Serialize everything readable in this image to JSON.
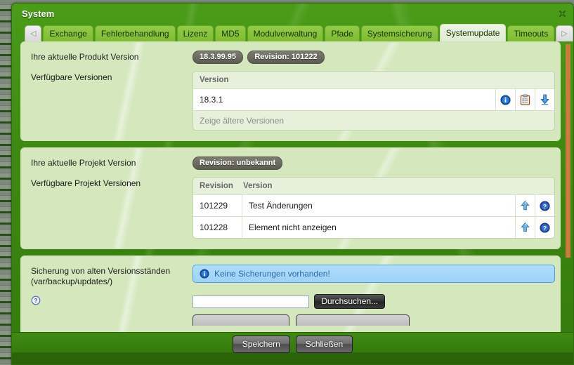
{
  "window": {
    "title": "System",
    "close_icon": "close-icon"
  },
  "tabs": {
    "prev_label": "◁",
    "next_label": "▷",
    "menu_label": "▽",
    "items": [
      {
        "label": "Exchange",
        "selected": false
      },
      {
        "label": "Fehlerbehandlung",
        "selected": false
      },
      {
        "label": "Lizenz",
        "selected": false
      },
      {
        "label": "MD5",
        "selected": false
      },
      {
        "label": "Modulverwaltung",
        "selected": false
      },
      {
        "label": "Pfade",
        "selected": false
      },
      {
        "label": "Systemsicherung",
        "selected": false
      },
      {
        "label": "Systemupdate",
        "selected": true
      },
      {
        "label": "Timeouts",
        "selected": false
      }
    ]
  },
  "product_section": {
    "current_label": "Ihre aktuelle Produkt Version",
    "badges": [
      "18.3.99.95",
      "Revision: 101222"
    ],
    "available_label": "Verfügbare Versionen",
    "table": {
      "header": [
        "Version"
      ],
      "rows": [
        {
          "version": "18.3.1",
          "actions": [
            "info-icon",
            "clipboard-icon",
            "download-icon"
          ]
        }
      ],
      "footer": "Zeige ältere Versionen"
    }
  },
  "project_section": {
    "current_label": "Ihre aktuelle Projekt Version",
    "badges": [
      "Revision: unbekannt"
    ],
    "available_label": "Verfügbare Projekt Versionen",
    "table": {
      "header": [
        "Revision",
        "Version"
      ],
      "rows": [
        {
          "revision": "101229",
          "version": "Test Änderungen",
          "actions": [
            "upload-icon",
            "help-icon"
          ]
        },
        {
          "revision": "101228",
          "version": "Element nicht anzeigen",
          "actions": [
            "upload-icon",
            "help-icon"
          ]
        }
      ]
    }
  },
  "backup_section": {
    "label_line1": "Sicherung von alten Versionsständen",
    "label_line2": "(var/backup/updates/)",
    "help_icon": "help-icon",
    "info_message": "Keine Sicherungen vorhanden!",
    "info_icon": "info-icon",
    "file_input_value": "",
    "file_input_placeholder": "",
    "browse_label": "Durchsuchen..."
  },
  "footer": {
    "save_label": "Speichern",
    "close_label": "Schließen"
  },
  "scrollbar": {
    "thumb_color": "#cc7a3d"
  }
}
